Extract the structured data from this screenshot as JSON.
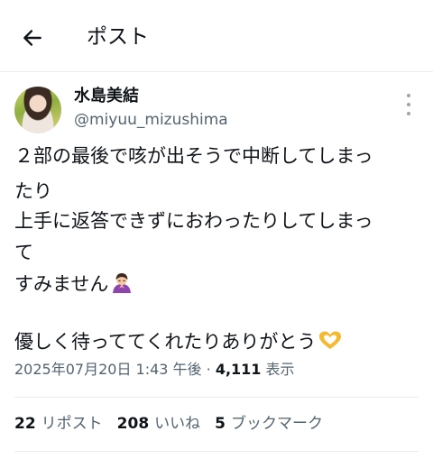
{
  "header": {
    "title": "ポスト",
    "back_icon": "arrow-left-icon"
  },
  "post": {
    "author_name": "水島美結",
    "author_handle": "@miyuu_mizushima",
    "more_icon": "vertical-dots-icon",
    "lines": [
      "２部の最後で咳が出そうで中断してしまっ",
      "たり",
      "上手に返答できずにおわったりしてしまっ",
      "て",
      "すみません",
      "優しく待っててくれたりありがとう"
    ],
    "emoji": {
      "apology": "person-bowing-emoji",
      "heart": "heart-hands-emoji"
    },
    "timestamp": "2025年07月20日 1:43 午後",
    "separator": "·",
    "views_count": "4,111",
    "views_label": "表示",
    "stats": {
      "reposts_count": "22",
      "reposts_label": "リポスト",
      "likes_count": "208",
      "likes_label": "いいね",
      "bookmarks_count": "5",
      "bookmarks_label": "ブックマーク"
    }
  },
  "colors": {
    "text": "#0f1419",
    "secondary": "#536471",
    "divider": "#e6ecf0",
    "heart_emoji": "#f5b82e"
  }
}
